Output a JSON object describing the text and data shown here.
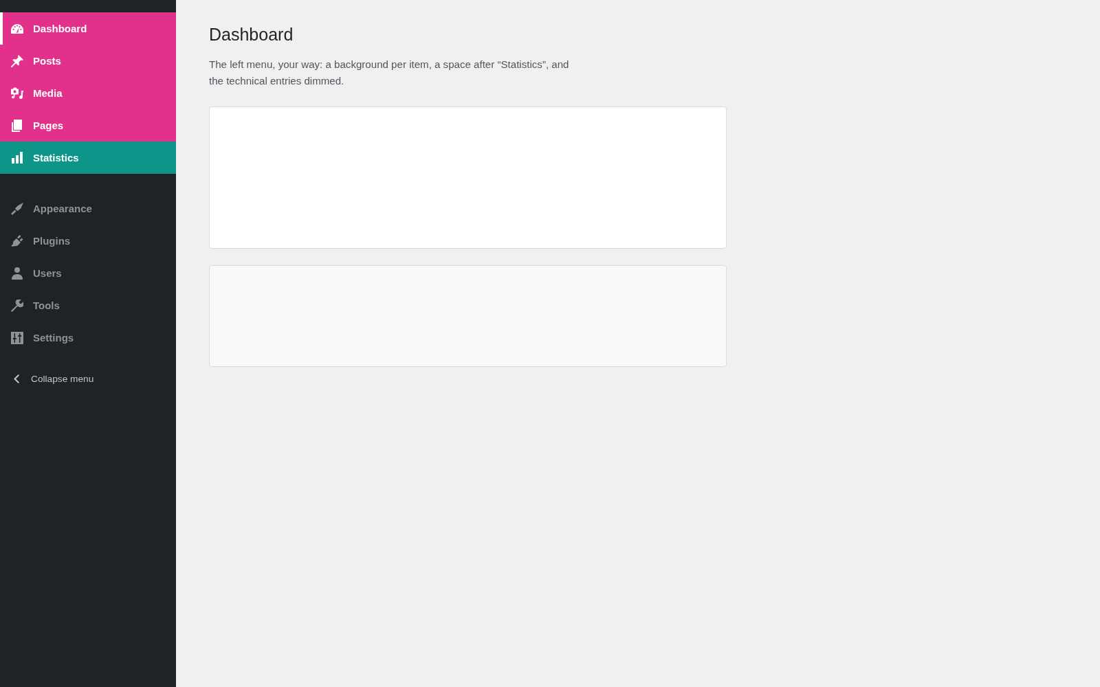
{
  "sidebar": {
    "groups": [
      {
        "items": [
          {
            "label": "Dashboard",
            "selected": true,
            "dimmed": false,
            "color": "#e1318a"
          },
          {
            "label": "Posts",
            "selected": false,
            "dimmed": false,
            "color": "#e1318a"
          },
          {
            "label": "Media",
            "selected": false,
            "dimmed": false,
            "color": "#e1318a"
          },
          {
            "label": "Pages",
            "selected": false,
            "dimmed": false,
            "color": "#e1318a"
          },
          {
            "label": "Statistics",
            "selected": false,
            "dimmed": false,
            "color": "#0e9589"
          }
        ]
      },
      {
        "items": [
          {
            "label": "Appearance",
            "selected": false,
            "dimmed": true
          },
          {
            "label": "Plugins",
            "selected": false,
            "dimmed": true
          },
          {
            "label": "Users",
            "selected": false,
            "dimmed": true
          },
          {
            "label": "Tools",
            "selected": false,
            "dimmed": true
          },
          {
            "label": "Settings",
            "selected": false,
            "dimmed": true
          }
        ]
      }
    ],
    "collapse_button": {
      "label": "Collapse menu"
    }
  },
  "main": {
    "title": "Dashboard",
    "description": "The left menu, your way: a background per item, a space after “Statistics”, and the technical entries dimmed.",
    "panels": [
      {
        "kind": "plain"
      },
      {
        "kind": "shaded"
      }
    ]
  }
}
